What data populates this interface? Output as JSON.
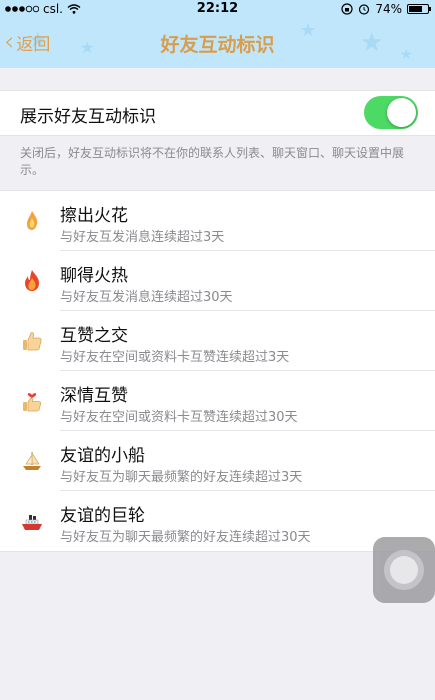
{
  "status_bar": {
    "carrier": "csl.",
    "time": "22:12",
    "battery": "74%",
    "battery_level": 0.74,
    "signal_dots": 5,
    "icons": [
      "wifi-icon",
      "rotation-lock-icon",
      "alarm-icon",
      "battery-icon"
    ]
  },
  "navbar": {
    "back_label": "返回",
    "title": "好友互动标识"
  },
  "toggle": {
    "label": "展示好友互动标识",
    "on": true
  },
  "description": "关闭后，好友互动标识将不在你的联系人列表、聊天窗口、聊天设置中展示。",
  "items": [
    {
      "icon": "small-flame-icon",
      "title": "擦出火花",
      "subtitle": "与好友互发消息连续超过3天"
    },
    {
      "icon": "big-flame-icon",
      "title": "聊得火热",
      "subtitle": "与好友互发消息连续超过30天"
    },
    {
      "icon": "thumbs-up-icon",
      "title": "互赞之交",
      "subtitle": "与好友在空间或资料卡互赞连续超过3天"
    },
    {
      "icon": "heart-thumbs-up-icon",
      "title": "深情互赞",
      "subtitle": "与好友在空间或资料卡互赞连续超过30天"
    },
    {
      "icon": "sailboat-icon",
      "title": "友谊的小船",
      "subtitle": "与好友互为聊天最频繁的好友连续超过3天"
    },
    {
      "icon": "ship-icon",
      "title": "友谊的巨轮",
      "subtitle": "与好友互为聊天最频繁的好友连续超过30天"
    }
  ],
  "colors": {
    "header_bg": "#bfe6fb",
    "accent": "#d99d4b",
    "switch_on": "#4cd964"
  }
}
